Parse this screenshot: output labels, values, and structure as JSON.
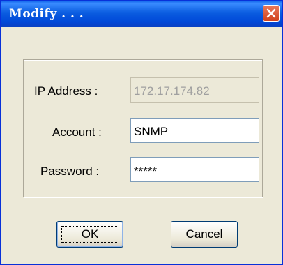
{
  "dialog": {
    "title": "Modify . . .",
    "close_icon": "close-icon"
  },
  "form": {
    "ip_label_prefix": "",
    "ip_label": "IP Address :",
    "ip_value": "172.17.174.82",
    "account_label_mnemonic": "A",
    "account_label_rest": "ccount :",
    "account_value": "SNMP",
    "password_label_mnemonic": "P",
    "password_label_rest": "assword :",
    "password_value": "*****"
  },
  "buttons": {
    "ok_mnemonic": "O",
    "ok_rest": "K",
    "cancel_mnemonic": "C",
    "cancel_rest": "ancel"
  },
  "colors": {
    "titlebar": "#0054e3",
    "dialog_bg": "#ece9d8",
    "close_button": "#d6532c"
  }
}
